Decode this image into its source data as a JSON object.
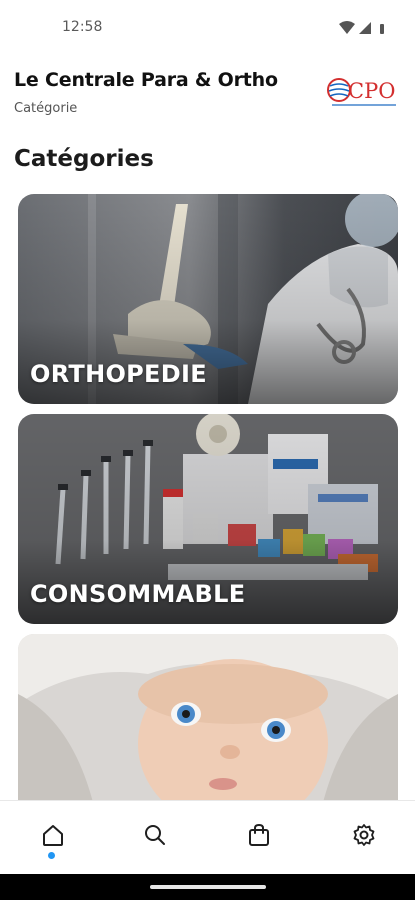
{
  "status_bar": {
    "time": "12:58",
    "icons": [
      "wifi-icon",
      "signal-icon",
      "battery-icon"
    ]
  },
  "header": {
    "title": "Le Centrale Para & Ortho",
    "subtitle": "Catégorie",
    "logo_text": "CPO",
    "logo_colors": [
      "#d32f2f",
      "#1565c0"
    ]
  },
  "section_title": "Catégories",
  "categories": [
    {
      "label": "ORTHOPEDIE",
      "image": "orthopedic-image"
    },
    {
      "label": "CONSOMMABLE",
      "image": "medical-supplies-image"
    },
    {
      "label": "",
      "image": "baby-image"
    }
  ],
  "bottom_nav": {
    "items": [
      {
        "icon": "home-icon",
        "active": true
      },
      {
        "icon": "search-icon",
        "active": false
      },
      {
        "icon": "shopping-bag-icon",
        "active": false
      },
      {
        "icon": "settings-icon",
        "active": false
      }
    ],
    "active_color": "#2196f3"
  }
}
